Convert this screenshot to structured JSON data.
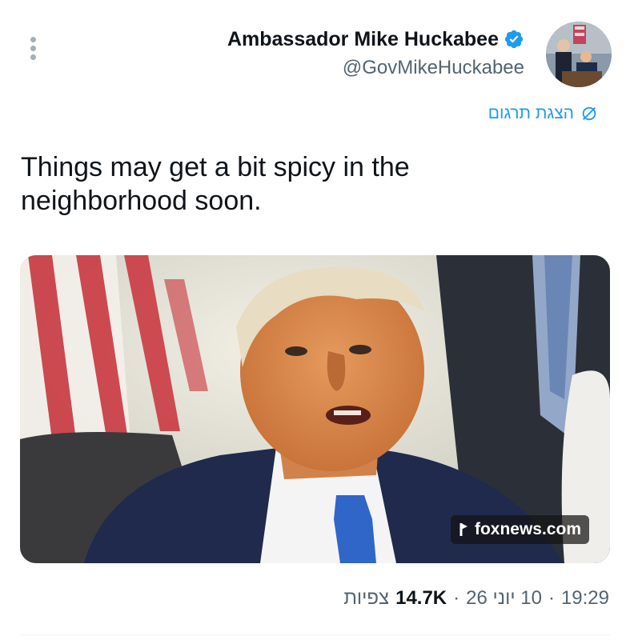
{
  "author": {
    "name": "Ambassador Mike Huckabee",
    "handle": "@GovMikeHuckabee",
    "verified_color": "#1d9bf0"
  },
  "translate": {
    "label": "הצגת תרגום",
    "icon": "globe-strike-icon"
  },
  "tweet": {
    "text": "Things may get a bit spicy in the neighborhood soon."
  },
  "media": {
    "link_domain": "foxnews.com",
    "alt": "photo"
  },
  "meta": {
    "time": "19:29",
    "date": "10 יוני 26",
    "views_count": "14.7K",
    "views_label": "צפיות",
    "separator": "·"
  },
  "colors": {
    "accent": "#1d9bf0",
    "text_primary": "#0f1419",
    "text_secondary": "#536471"
  }
}
